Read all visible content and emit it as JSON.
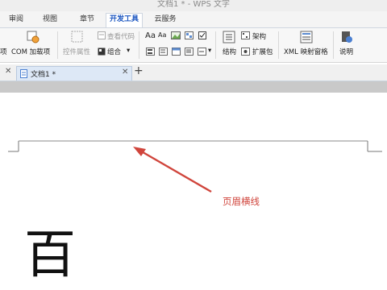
{
  "window": {
    "title": "文档1 * - WPS 文字"
  },
  "menu_tabs": [
    {
      "label": "审阅"
    },
    {
      "label": "视图"
    },
    {
      "label": "章节"
    },
    {
      "label": "开发工具"
    },
    {
      "label": "云服务"
    }
  ],
  "ribbon": {
    "cut_addin_label": "项",
    "com_addin_label": "COM 加载项",
    "control_props_label": "控件属性",
    "view_code_label": "查看代码",
    "group_label": "组合",
    "structure_label": "架构",
    "structure2_label": "结构",
    "expansion_label": "扩展包",
    "xml_mapping_label": "XML 映射窗格",
    "help_label": "说明",
    "aa1": "Aa",
    "aa2": "Aa"
  },
  "doc_tabs": [
    {
      "label": "文档1 *"
    }
  ],
  "annotation": "页眉横线",
  "body_text": "百",
  "colors": {
    "accent": "#1a55c0",
    "annotation": "#d0453c"
  }
}
